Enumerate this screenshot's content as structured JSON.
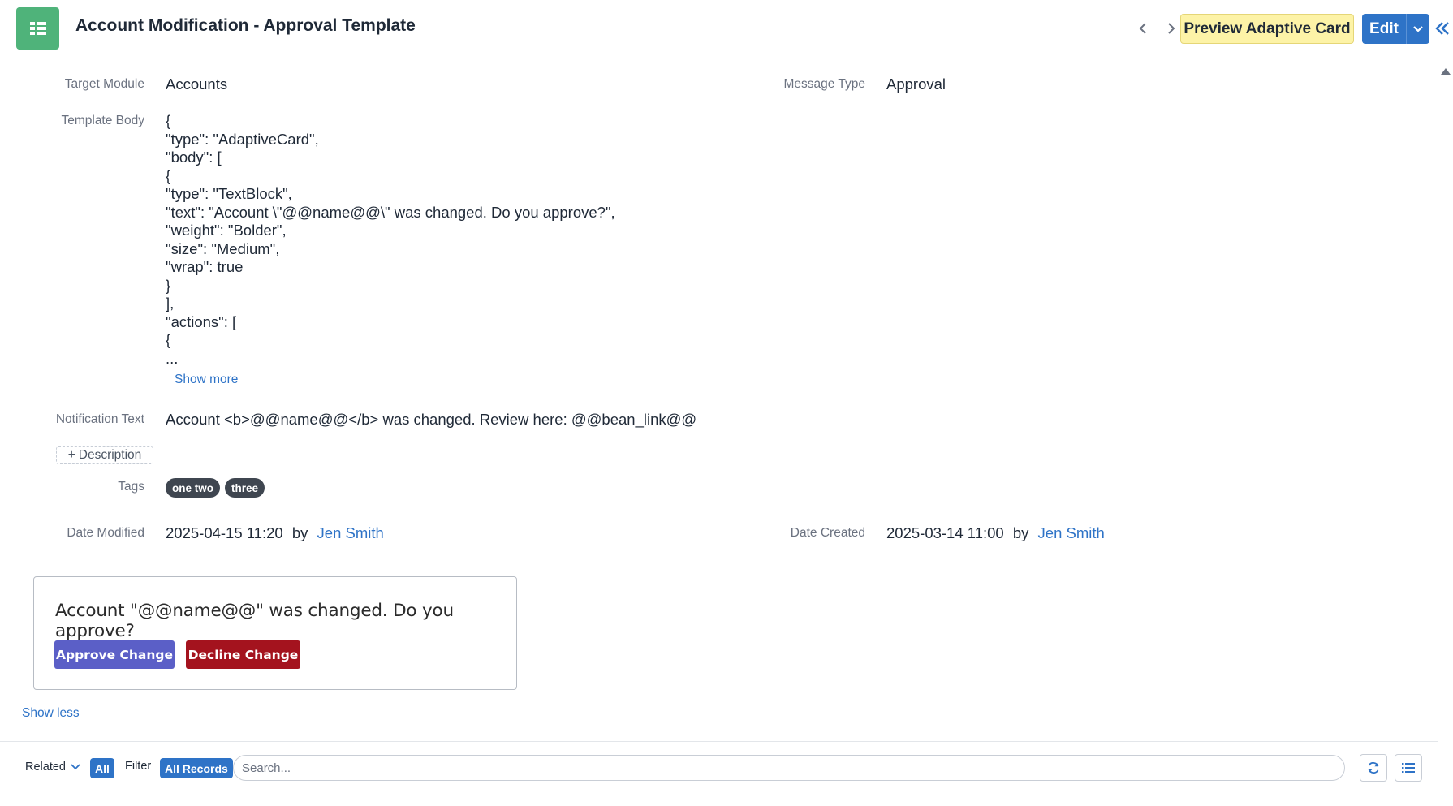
{
  "header": {
    "title": "Account Modification - Approval Template",
    "module_icon": "module-list-icon",
    "preview_label": "Preview Adaptive Card",
    "edit_label": "Edit"
  },
  "fields": {
    "target_module": {
      "label": "Target Module",
      "value": "Accounts"
    },
    "message_type": {
      "label": "Message Type",
      "value": "Approval"
    },
    "template_body": {
      "label": "Template Body",
      "lines": [
        "{",
        "\"type\": \"AdaptiveCard\",",
        "\"body\": [",
        "{",
        "\"type\": \"TextBlock\",",
        "\"text\": \"Account \\\"@@name@@\\\" was changed. Do you approve?\",",
        "\"weight\": \"Bolder\",",
        "\"size\": \"Medium\",",
        "\"wrap\": true",
        "}",
        "],",
        "\"actions\": [",
        "{",
        "..."
      ],
      "show_more": "Show more"
    },
    "notification_text": {
      "label": "Notification Text",
      "value": "Account <b>@@name@@</b> was changed. Review here: @@bean_link@@"
    },
    "description_button": "Description",
    "tags": {
      "label": "Tags",
      "items": [
        "one two",
        "three"
      ]
    },
    "date_modified": {
      "label": "Date Modified",
      "value": "2025-04-15 11:20",
      "by": "by",
      "user": "Jen Smith"
    },
    "date_created": {
      "label": "Date Created",
      "value": "2025-03-14 11:00",
      "by": "by",
      "user": "Jen Smith"
    }
  },
  "card_preview": {
    "text": "Account \"@@name@@\" was changed. Do you approve?",
    "approve_label": "Approve Change",
    "decline_label": "Decline Change",
    "approve_color": "#5b5fc7",
    "decline_color": "#a4131e"
  },
  "show_less": "Show less",
  "related_bar": {
    "related_label": "Related",
    "all_label": "All",
    "filter_label": "Filter",
    "all_records_label": "All Records",
    "search_placeholder": "Search..."
  },
  "colors": {
    "accent": "#2e73c7",
    "module_icon_bg": "#4fb37a",
    "preview_button_bg": "#fdf3a7",
    "tag_bg": "#3f4650"
  }
}
